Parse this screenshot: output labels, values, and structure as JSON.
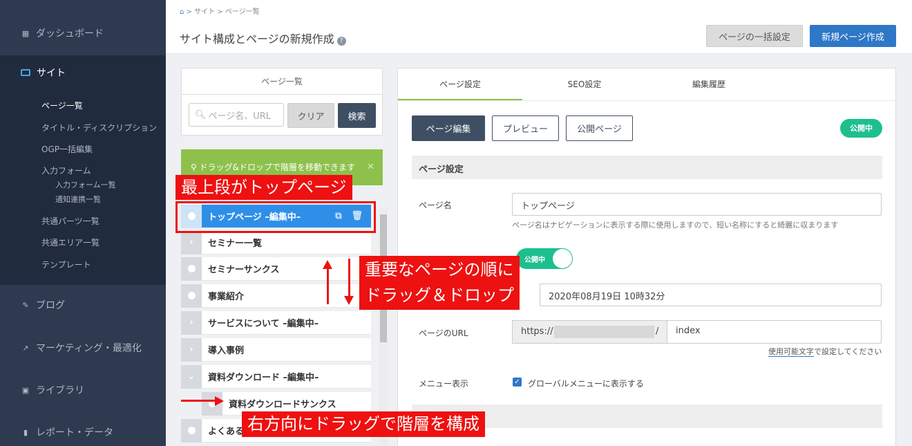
{
  "sidebar": {
    "dashboard": "ダッシュボード",
    "site": "サイト",
    "site_items": [
      "ページ一覧",
      "タイトル・ディスクリプション",
      "OGP一括編集",
      "入力フォーム",
      "共通パーツ一覧",
      "共通エリア一覧",
      "テンプレート"
    ],
    "form_items": [
      "入力フォーム一覧",
      "通知連携一覧"
    ],
    "blog": "ブログ",
    "marketing": "マーケティング・最適化",
    "library": "ライブラリ",
    "report": "レポート・データ"
  },
  "header": {
    "breadcrumb_site": "サイト",
    "breadcrumb_pages": "ページ一覧",
    "title": "サイト構成とページの新規作成",
    "bulk_button": "ページの一括設定",
    "new_button": "新規ページ作成"
  },
  "list_panel": {
    "title": "ページ一覧",
    "search_placeholder": "ページ名、URL",
    "clear_button": "クリア",
    "search_button": "検索",
    "alert": "ドラッグ&ドロップで階層を移動できます",
    "rows": [
      "トップページ –編集中–",
      "セミナー一覧",
      "セミナーサンクス",
      "事業紹介",
      "サービスについて –編集中–",
      "導入事例",
      "資料ダウンロード –編集中–",
      "資料ダウンロードサンクス",
      "よくある"
    ]
  },
  "main_panel": {
    "tabs": [
      "ページ設定",
      "SEO設定",
      "編集履歴"
    ],
    "edit_button": "ページ編集",
    "preview_button": "プレビュー",
    "public_button": "公開ページ",
    "status_badge": "公開中",
    "section_title": "ページ設定",
    "page_name_label": "ページ名",
    "page_name_value": "トップページ",
    "page_name_help": "ページ名はナビゲーションに表示する際に使用しますので、短い名称にすると綺麗に収まります",
    "toggle_label": "公開中",
    "date_value": "2020年08月19日 10時32分",
    "url_label": "ページのURL",
    "url_prefix": "https://",
    "url_slash": "/",
    "url_value": "index",
    "url_note_link": "使用可能文字",
    "url_note_rest": "で設定してください",
    "menu_label": "メニュー表示",
    "menu_checkbox_label": "グローバルメニューに表示する"
  },
  "annotations": {
    "top_page": "最上段がトップページ",
    "order_line1": "重要なページの順に",
    "order_line2": "ドラッグ＆ドロップ",
    "hierarchy": "右方向にドラッグで階層を構成"
  },
  "colors": {
    "sidebar_bg": "#2e3a4f",
    "primary": "#2f77c7",
    "success": "#1dbf8f",
    "alert_green": "#8dc14c",
    "annotation_red": "#ee1111"
  }
}
